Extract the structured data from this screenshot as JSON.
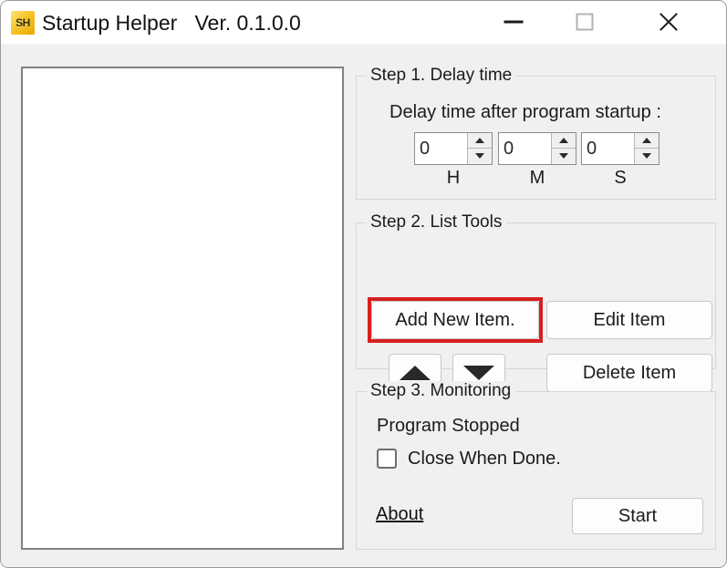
{
  "window": {
    "title": "Startup Helper   Ver. 0.1.0.0",
    "icon_label": "SH",
    "icon_name": "app-icon-sh",
    "controls": {
      "minimize_name": "minimize-icon",
      "maximize_name": "maximize-icon",
      "close_name": "close-icon"
    }
  },
  "list_panel": {
    "name": "startup-items-list",
    "items": []
  },
  "step1": {
    "legend": "Step 1. Delay time",
    "description": "Delay time after program startup :",
    "fields": [
      {
        "value": "0",
        "unit": "H",
        "name": "delay-hours"
      },
      {
        "value": "0",
        "unit": "M",
        "name": "delay-minutes"
      },
      {
        "value": "0",
        "unit": "S",
        "name": "delay-seconds"
      }
    ]
  },
  "step2": {
    "legend": "Step 2. List Tools",
    "add_new_label": "Add New Item.",
    "edit_label": "Edit Item",
    "delete_label": "Delete Item",
    "move_up_icon": "triangle-up-icon",
    "move_down_icon": "triangle-down-icon",
    "highlight_color": "#d81f1f",
    "highlighted_control": "Add New Item."
  },
  "step3": {
    "legend": "Step 3. Monitoring",
    "status": "Program Stopped",
    "close_when_done_label": "Close When Done.",
    "close_when_done_checked": false,
    "about_label": "About",
    "start_label": "Start"
  }
}
